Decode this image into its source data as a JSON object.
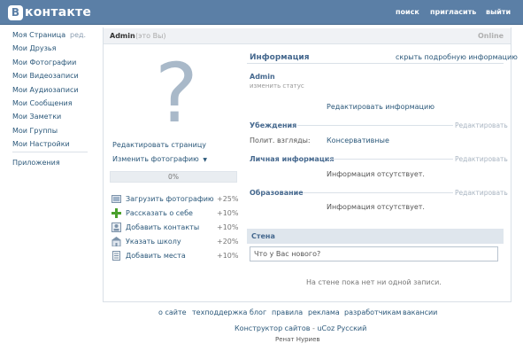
{
  "header": {
    "logo_letter": "В",
    "logo_text": "контакте",
    "nav": [
      "поиск",
      "пригласить",
      "выйти"
    ]
  },
  "sidebar": {
    "items": [
      "Моя Страница",
      "Мои Друзья",
      "Мои Фотографии",
      "Мои Видеозаписи",
      "Мои Аудиозаписи",
      "Мои Сообщения",
      "Мои Заметки",
      "Мои Группы",
      "Мои Настройки"
    ],
    "edit_label": "ред.",
    "apps_label": "Приложения"
  },
  "profile": {
    "name": "Admin",
    "you_label": "(это Вы)",
    "online": "Online",
    "photo_placeholder": "?",
    "edit_page": "Редактировать страницу",
    "change_photo": "Изменить фотографию",
    "progress": {
      "percent": 0,
      "label": "0%"
    }
  },
  "tasks": [
    {
      "label": "Загрузить фотографию",
      "bonus": "+25%",
      "icon": "photo-icon"
    },
    {
      "label": "Рассказать о себе",
      "bonus": "+10%",
      "icon": "plus-icon"
    },
    {
      "label": "Добавить контакты",
      "bonus": "+10%",
      "icon": "contacts-icon"
    },
    {
      "label": "Указать школу",
      "bonus": "+20%",
      "icon": "school-icon"
    },
    {
      "label": "Добавить места",
      "bonus": "+10%",
      "icon": "places-icon"
    }
  ],
  "info": {
    "title": "Информация",
    "hide_link": "скрыть подробную информацию",
    "user_name": "Admin",
    "status_link": "изменить статус",
    "edit_info": "Редактировать информацию",
    "sections": [
      {
        "title": "Убеждения",
        "edit": "Редактировать"
      },
      {
        "title": "Личная информация",
        "edit": "Редактировать",
        "empty": "Информация отсутствует."
      },
      {
        "title": "Образование",
        "edit": "Редактировать",
        "empty": "Информация отсутствует."
      }
    ],
    "politics_label": "Полит. взгляды:",
    "politics_value": "Консервативные"
  },
  "wall": {
    "title": "Стена",
    "input_placeholder": "Что у Вас нового?",
    "empty": "На стене пока нет ни одной записи."
  },
  "footer": {
    "links": [
      "о сайте",
      "техподдержка",
      "блог",
      "правила",
      "реклама",
      "разработчикам",
      "вакансии"
    ],
    "credit_link1": "Конструктор сайтов",
    "credit_sep": "-",
    "credit_link2": "uCoz",
    "credit_lang": "Русский",
    "author": "Ренат Нуриев"
  },
  "colors": {
    "header_bg": "#5b7fa6",
    "link": "#2B587A",
    "section_title": "#45688e"
  }
}
